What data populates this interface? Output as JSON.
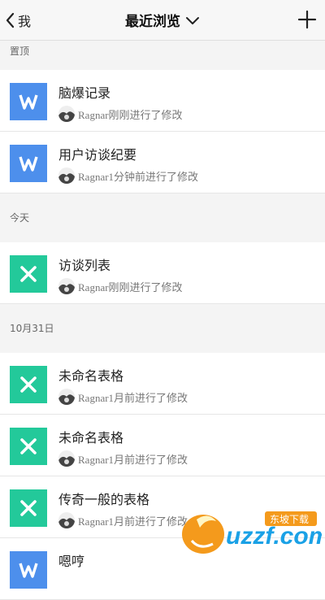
{
  "nav": {
    "back_label": "我",
    "title": "最近浏览"
  },
  "sections": {
    "pinned": "置顶",
    "today": "今天",
    "oct31": "10月31日"
  },
  "rows": [
    {
      "title": "脑爆记录",
      "subtitle": "Ragnar刚刚进行了修改",
      "type": "word"
    },
    {
      "title": "用户访谈纪要",
      "subtitle": "Ragnar1分钟前进行了修改",
      "type": "word"
    },
    {
      "title": "访谈列表",
      "subtitle": "Ragnar刚刚进行了修改",
      "type": "sheet"
    },
    {
      "title": "未命名表格",
      "subtitle": "Ragnar1月前进行了修改",
      "type": "sheet"
    },
    {
      "title": "未命名表格",
      "subtitle": "Ragnar1月前进行了修改",
      "type": "sheet"
    },
    {
      "title": "传奇一般的表格",
      "subtitle": "Ragnar1月前进行了修改",
      "type": "sheet"
    },
    {
      "title": "嗯哼",
      "subtitle": "",
      "type": "word"
    }
  ],
  "watermark": {
    "brand": "uzzf.com",
    "tagline": "东坡下载"
  },
  "colors": {
    "word_icon": "#4d8fec",
    "sheet_icon": "#23c99a",
    "section_bg": "#f4f4f4"
  },
  "icons": {
    "back": "chevron-left-icon",
    "title_dropdown": "chevron-down-icon",
    "add": "plus-icon",
    "word": "word-doc-icon",
    "sheet": "sheet-doc-icon"
  }
}
